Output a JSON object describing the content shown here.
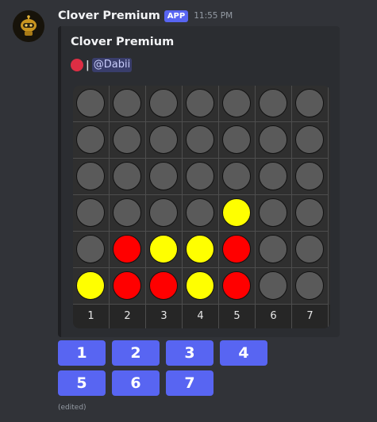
{
  "message": {
    "username": "Clover Premium",
    "app_tag": "APP",
    "timestamp": "11:55 PM",
    "edited": "(edited)"
  },
  "embed": {
    "title": "Clover Premium",
    "turn_indicator": "red-disc-icon",
    "separator": "|",
    "mention": "@Dabii"
  },
  "board": {
    "columns": 7,
    "rows": 6,
    "cells": [
      [
        "empty",
        "empty",
        "empty",
        "empty",
        "empty",
        "empty",
        "empty"
      ],
      [
        "empty",
        "empty",
        "empty",
        "empty",
        "empty",
        "empty",
        "empty"
      ],
      [
        "empty",
        "empty",
        "empty",
        "empty",
        "empty",
        "empty",
        "empty"
      ],
      [
        "empty",
        "empty",
        "empty",
        "empty",
        "yellow",
        "empty",
        "empty"
      ],
      [
        "empty",
        "red",
        "yellow",
        "yellow",
        "red",
        "empty",
        "empty"
      ],
      [
        "yellow",
        "red",
        "red",
        "yellow",
        "red",
        "empty",
        "empty"
      ]
    ],
    "column_labels": [
      "1",
      "2",
      "3",
      "4",
      "5",
      "6",
      "7"
    ],
    "colors": {
      "red": "#ff0000",
      "yellow": "#ffff00",
      "empty": "#5a5a5a"
    }
  },
  "buttons": [
    "1",
    "2",
    "3",
    "4",
    "5",
    "6",
    "7"
  ],
  "colors": {
    "accent": "#5865f2",
    "background": "#313338",
    "embed_background": "#2b2d31"
  }
}
